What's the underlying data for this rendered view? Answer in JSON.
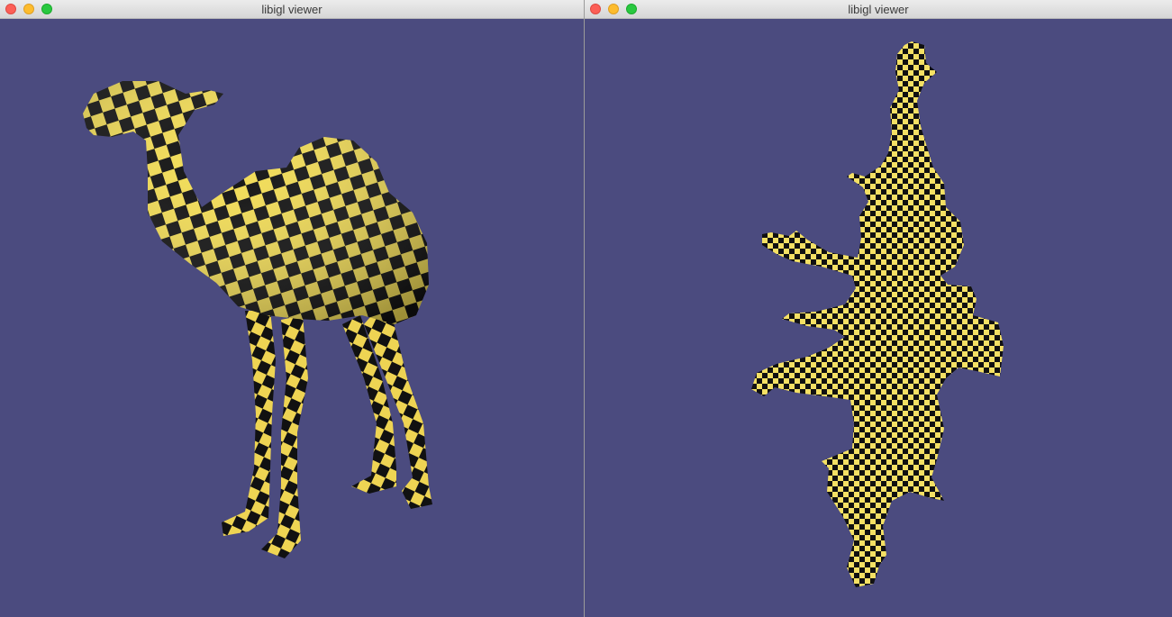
{
  "windows": [
    {
      "title": "libigl viewer",
      "content": "3d-camel-mesh-checkerboard-texture"
    },
    {
      "title": "libigl viewer",
      "content": "2d-uv-parameterization-checkerboard"
    }
  ],
  "colors": {
    "viewport_background": "#4b4b7f",
    "checker_light": "#f2dc55",
    "checker_dark": "#111111",
    "close_button": "#fc5f57",
    "minimize_button": "#fdbc2e",
    "zoom_button": "#29c840"
  }
}
